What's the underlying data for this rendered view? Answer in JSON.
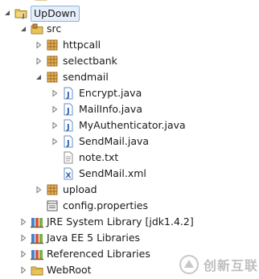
{
  "tree": {
    "project": "UpDown",
    "src": "src",
    "packages": {
      "httpcall": "httpcall",
      "selectbank": "selectbank",
      "sendmail": "sendmail",
      "upload": "upload"
    },
    "sendmail_children": [
      "Encrypt.java",
      "MailInfo.java",
      "MyAuthenticator.java",
      "SendMail.java",
      "note.txt",
      "SendMail.xml"
    ],
    "config": "config.properties",
    "libraries": [
      "JRE System Library [jdk1.4.2]",
      "Java EE 5 Libraries",
      "Referenced Libraries"
    ],
    "webroot": "WebRoot"
  },
  "watermark": {
    "text": "创新互联"
  }
}
